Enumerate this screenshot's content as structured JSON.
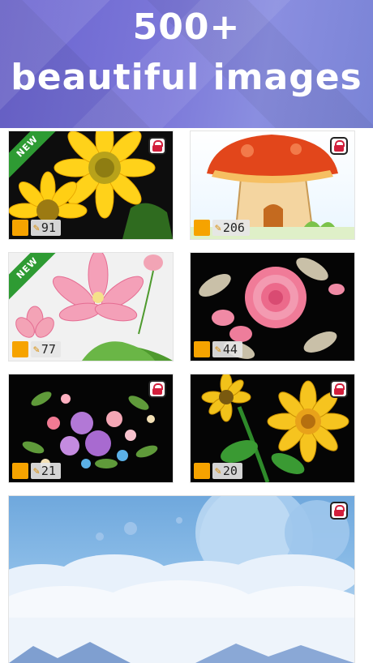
{
  "banner": {
    "line1": "500+",
    "line2": "beautiful images"
  },
  "badge_new": "NEW",
  "cards": [
    {
      "name": "sunflower",
      "count": "91",
      "new": true,
      "locked": true
    },
    {
      "name": "mushroom-house",
      "count": "206",
      "new": false,
      "locked": true
    },
    {
      "name": "lotus",
      "count": "77",
      "new": true,
      "locked": false
    },
    {
      "name": "rose",
      "count": "44",
      "new": false,
      "locked": false
    },
    {
      "name": "bouquet",
      "count": "21",
      "new": false,
      "locked": true
    },
    {
      "name": "sunflowers",
      "count": "20",
      "new": false,
      "locked": true
    },
    {
      "name": "sky-moons",
      "locked": true
    }
  ],
  "colors": {
    "accent": "#f6a300",
    "new_badge": "#2e9b33",
    "lock": "#d21f3c",
    "banner": "#7c78d9"
  },
  "icons": {
    "lock": "lock-icon",
    "pencil": "pencil-icon"
  }
}
